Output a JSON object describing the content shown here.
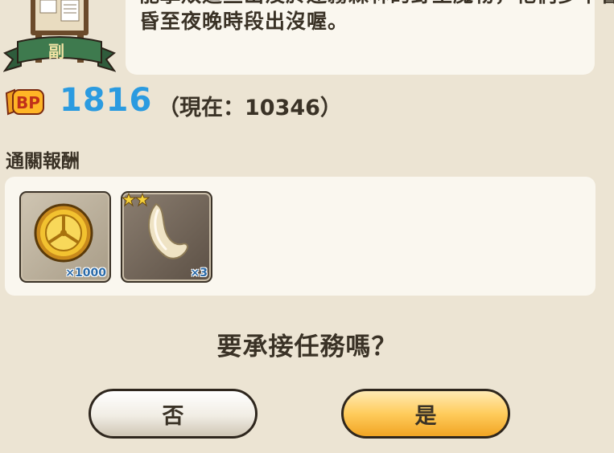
{
  "quest": {
    "description_line_top": "能擊敗這些出沒於迷霧森林的野生魔物，牠們多半會在",
    "description_line": "昏至夜晚時段出沒喔。",
    "badge_label": "副"
  },
  "bp": {
    "icon_label": "BP",
    "value": "1816",
    "current": "（現在：10346）"
  },
  "rewards": {
    "title": "通關報酬",
    "items": [
      {
        "name": "gold-coin",
        "qty": "×1000",
        "stars": 0
      },
      {
        "name": "fang",
        "qty": "×3",
        "stars": 2
      }
    ]
  },
  "prompt": {
    "question": "要承接任務嗎？",
    "no_label": "否",
    "yes_label": "是"
  },
  "colors": {
    "background": "#ece4d3",
    "panel": "#faf7ef",
    "bp_value": "#2b9be0",
    "yes_button": "#ffcc5c"
  }
}
